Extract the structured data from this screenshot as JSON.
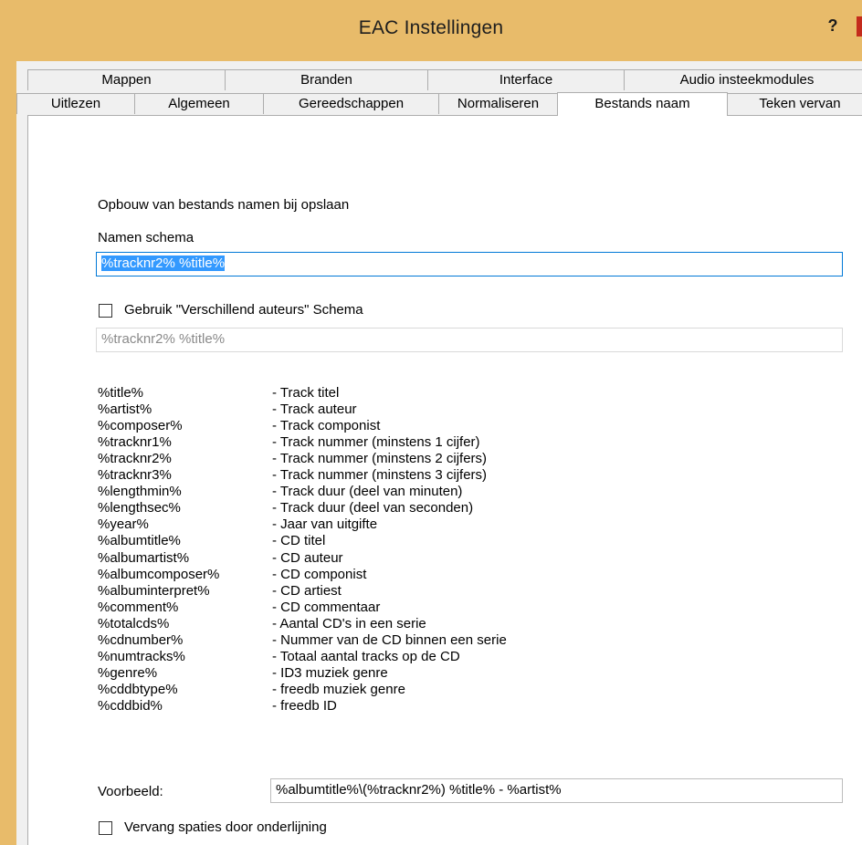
{
  "window": {
    "title": "EAC Instellingen",
    "help_label": "?"
  },
  "tabs_back": [
    "Mappen",
    "Branden",
    "Interface",
    "Audio insteekmodules"
  ],
  "tabs_front": [
    "Uitlezen",
    "Algemeen",
    "Gereedschappen",
    "Normaliseren",
    "Bestands naam",
    "Teken vervan"
  ],
  "active_tab": "Bestands naam",
  "panel": {
    "section_heading": "Opbouw van bestands namen bij opslaan",
    "scheme_label": "Namen schema",
    "scheme_value": "%tracknr2% %title%",
    "various_checkbox_label": "Gebruik \"Verschillend auteurs\" Schema",
    "various_checked": false,
    "various_value": "%tracknr2% %title%",
    "variables": [
      {
        "placeholder": "%title%",
        "description": "- Track titel"
      },
      {
        "placeholder": "%artist%",
        "description": "- Track auteur"
      },
      {
        "placeholder": "%composer%",
        "description": "- Track componist"
      },
      {
        "placeholder": "%tracknr1%",
        "description": "- Track nummer (minstens 1 cijfer)"
      },
      {
        "placeholder": "%tracknr2%",
        "description": "- Track nummer (minstens 2 cijfers)"
      },
      {
        "placeholder": "%tracknr3%",
        "description": "- Track nummer (minstens 3 cijfers)"
      },
      {
        "placeholder": "%lengthmin%",
        "description": "- Track duur (deel van minuten)"
      },
      {
        "placeholder": "%lengthsec%",
        "description": "- Track duur (deel van seconden)"
      },
      {
        "placeholder": "%year%",
        "description": "- Jaar van uitgifte"
      },
      {
        "placeholder": "%albumtitle%",
        "description": "- CD titel"
      },
      {
        "placeholder": "%albumartist%",
        "description": "- CD auteur"
      },
      {
        "placeholder": "%albumcomposer%",
        "description": "- CD componist"
      },
      {
        "placeholder": "%albuminterpret%",
        "description": "- CD artiest"
      },
      {
        "placeholder": "%comment%",
        "description": "- CD commentaar"
      },
      {
        "placeholder": "%totalcds%",
        "description": "- Aantal CD's in een serie"
      },
      {
        "placeholder": "%cdnumber%",
        "description": "- Nummer van de CD binnen een serie"
      },
      {
        "placeholder": "%numtracks%",
        "description": "- Totaal aantal tracks op de CD"
      },
      {
        "placeholder": "%genre%",
        "description": "- ID3 muziek genre"
      },
      {
        "placeholder": "%cddbtype%",
        "description": "- freedb muziek genre"
      },
      {
        "placeholder": "%cddbid%",
        "description": "- freedb ID"
      }
    ],
    "example_label": "Voorbeeld:",
    "example_value": "%albumtitle%\\(%tracknr2%) %title% - %artist%",
    "replace_spaces_label": "Vervang spaties door onderlijning",
    "replace_spaces_checked": false
  },
  "colors": {
    "titlebar": "#e8bb6a",
    "selection": "#3399ff",
    "focus_border": "#0078d7",
    "close": "#c42b1c"
  }
}
